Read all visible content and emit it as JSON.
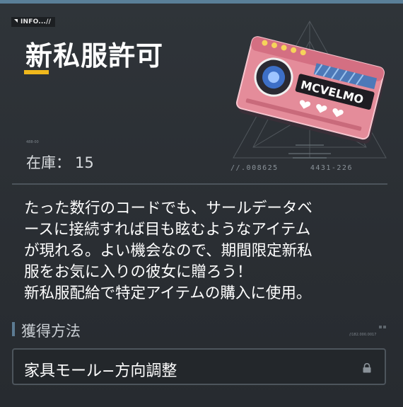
{
  "header": {
    "tag": "INFO...//",
    "title": "新私服許可",
    "tiny_id": "488-00"
  },
  "item": {
    "logo_text": "MCVELMO",
    "stock_label": "在庫：",
    "stock_value": "15",
    "code_left": "//.008625",
    "code_right": "4431-226",
    "icon": "ticket-icon",
    "accent_color": "#f0b81c",
    "ticket_color": "#e48c9a"
  },
  "description": {
    "lines": [
      "たった数行のコードでも、サールデータベ",
      "ースに接続すれば目も眩むようなアイテム",
      "が現れる。よい機会なので、期間限定新私",
      "服をお気に入りの彼女に贈ろう！",
      "新私服配給で特定アイテムの購入に使用。"
    ]
  },
  "acquisition": {
    "title": "獲得方法",
    "number": "//182.000.0017",
    "source_label": "家具モール−方向調整",
    "source_icon": "lock-icon"
  }
}
